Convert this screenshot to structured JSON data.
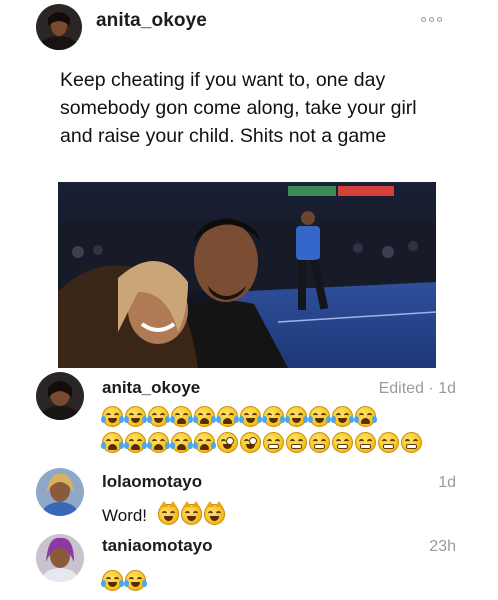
{
  "post": {
    "username": "anita_okoye",
    "more_icon": "more-dots-icon",
    "caption": "Keep cheating if you want to, one day somebody gon come along, take your girl and raise your child. Shits not a game",
    "photo_alt": "photo-of-couple-at-basketball-court"
  },
  "comments": [
    {
      "username": "anita_okoye",
      "meta": "Edited · 1d",
      "emoji_rows": [
        [
          "joy",
          "joy",
          "joy",
          "cry",
          "cry",
          "cry",
          "joy",
          "joy",
          "joy",
          "joy",
          "joy",
          "cry"
        ],
        [
          "cry",
          "cry",
          "cry",
          "cry",
          "cry",
          "zany",
          "zany",
          "grimace",
          "grimace",
          "grimace",
          "grimace",
          "grimace",
          "grimace",
          "grimace"
        ]
      ]
    },
    {
      "username": "lolaomotayo",
      "meta": "1d",
      "text": "Word!",
      "emojis": [
        "cat",
        "cat",
        "cat"
      ]
    },
    {
      "username": "taniaomotayo",
      "meta": "23h",
      "emojis": [
        "joy",
        "joy"
      ]
    }
  ],
  "colors": {
    "username": "#1c1c1c",
    "meta": "#9b9b9b",
    "text": "#111111"
  }
}
